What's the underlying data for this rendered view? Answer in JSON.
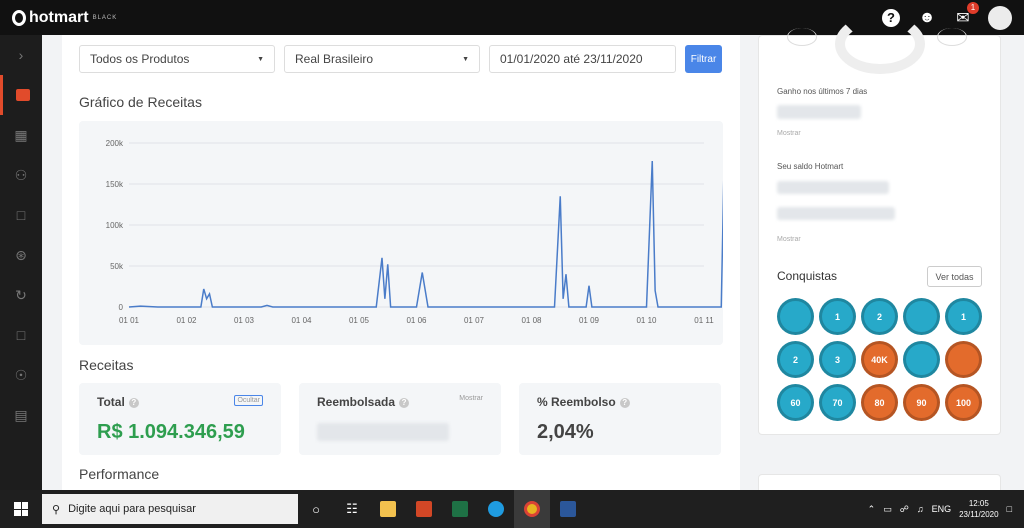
{
  "topbar": {
    "brand": "hotmart",
    "brand_sub": "BLACK",
    "help_icon": "?",
    "notifications_count": "1"
  },
  "sidebar": {
    "items": [
      "chevron-right-icon",
      "dashboard-icon",
      "grid-icon",
      "users-icon",
      "box-icon",
      "cart-icon",
      "refresh-icon",
      "chat-icon",
      "dollar-icon",
      "report-icon"
    ],
    "active_index": 1
  },
  "filters": {
    "product": "Todos os Produtos",
    "currency": "Real Brasileiro",
    "date_range": "01/01/2020 até 23/11/2020",
    "button": "Filtrar"
  },
  "revenue_chart": {
    "title": "Gráfico de Receitas"
  },
  "chart_data": {
    "type": "line",
    "x": [
      "01 01",
      "01 02",
      "01 03",
      "01 04",
      "01 05",
      "01 06",
      "01 07",
      "01 08",
      "01 09",
      "01 10",
      "01 11"
    ],
    "ylim": [
      0,
      200000
    ],
    "yticks": [
      "200k",
      "150k",
      "100k",
      "50k",
      "0"
    ],
    "grid": true,
    "accent": "#4a7cc9",
    "series": [
      {
        "points": [
          [
            0,
            0
          ],
          [
            0.2,
            1000
          ],
          [
            0.5,
            0
          ],
          [
            1.0,
            0
          ],
          [
            1.25,
            0
          ],
          [
            1.3,
            22000
          ],
          [
            1.35,
            10000
          ],
          [
            1.4,
            16000
          ],
          [
            1.45,
            0
          ],
          [
            2.3,
            0
          ],
          [
            2.4,
            2000
          ],
          [
            2.5,
            0
          ],
          [
            4.3,
            0
          ],
          [
            4.4,
            60000
          ],
          [
            4.45,
            10000
          ],
          [
            4.5,
            52000
          ],
          [
            4.55,
            0
          ],
          [
            5.0,
            0
          ],
          [
            5.1,
            42000
          ],
          [
            5.2,
            0
          ],
          [
            7.4,
            0
          ],
          [
            7.5,
            135000
          ],
          [
            7.55,
            10000
          ],
          [
            7.6,
            40000
          ],
          [
            7.65,
            0
          ],
          [
            7.95,
            0
          ],
          [
            8.0,
            26000
          ],
          [
            8.05,
            0
          ],
          [
            9.0,
            0
          ],
          [
            9.1,
            178000
          ],
          [
            9.15,
            20000
          ],
          [
            9.2,
            0
          ],
          [
            10.3,
            0
          ],
          [
            10.35,
            178000
          ],
          [
            10.4,
            20000
          ],
          [
            10.45,
            40000
          ],
          [
            10.5,
            0
          ],
          [
            10.8,
            0
          ]
        ]
      }
    ]
  },
  "revenue": {
    "title": "Receitas",
    "total_label": "Total",
    "total_value": "R$ 1.094.346,59",
    "total_link": "Ocultar",
    "refund_label": "Reembolsada",
    "refund_link": "Mostrar",
    "refund_pct_label": "% Reembolso",
    "refund_pct_value": "2,04%"
  },
  "performance": {
    "title": "Performance"
  },
  "right_panel": {
    "earned_label": "Ganho nos últimos 7 dias",
    "earned_show": "Mostrar",
    "balance_label": "Seu saldo Hotmart",
    "balance_show": "Mostrar",
    "achievements_title": "Conquistas",
    "view_all": "Ver todas",
    "badges": [
      "",
      "1",
      "2",
      "",
      "1",
      "2",
      "3",
      "40K",
      "",
      "",
      "60",
      "70",
      "80",
      "90",
      "100"
    ]
  },
  "taskbar": {
    "search_placeholder": "Digite aqui para pesquisar",
    "lang": "ENG",
    "time": "12:05",
    "date": "23/11/2020"
  }
}
